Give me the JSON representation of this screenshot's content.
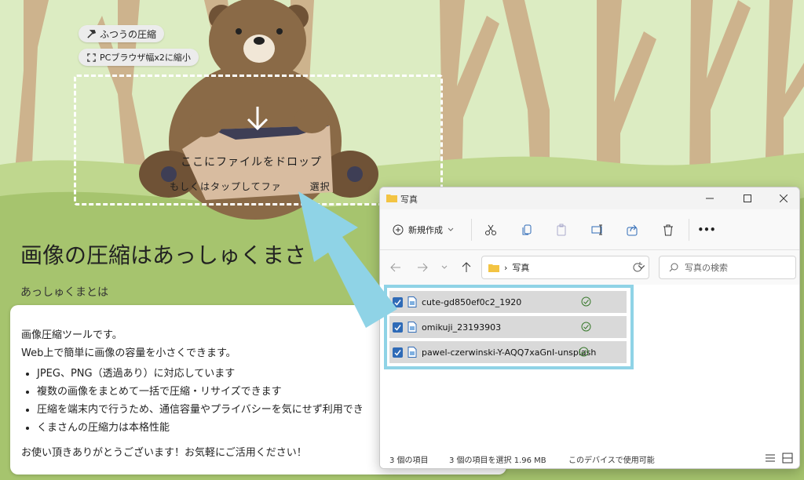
{
  "app": {
    "mode_chip": "ふつうの圧縮",
    "resize_chip": "PCブラウザ幅x2に縮小",
    "drop_title": "ここにファイルをドロップ",
    "drop_sub": "もしくはタップしてファ",
    "drop_sub_tail": "選択",
    "page_title": "画像の圧縮はあっしゅくまさ",
    "section_sub": "あっしゅくまとは",
    "card": {
      "intro1": "画像圧縮ツールです。",
      "intro2": "Web上で簡単に画像の容量を小さくできます。",
      "features": [
        "JPEG、PNG（透過あり）に対応しています",
        "複数の画像をまとめて一括で圧縮・リサイズできます",
        "圧縮を端末内で行うため、通信容量やプライバシーを気にせず利用でき",
        "くまさんの圧縮力は本格性能"
      ],
      "thanks": "お使い頂きありがとうございます！お気軽にご活用ください！"
    }
  },
  "explorer": {
    "title": "写真",
    "new_label": "新規作成",
    "address_folder": "写真",
    "address_sep": "›",
    "search_placeholder": "写真の検索",
    "files": [
      {
        "name": "cute-gd850ef0c2_1920",
        "checked": true
      },
      {
        "name": "omikuji_23193903",
        "checked": true
      },
      {
        "name": "pawel-czerwinski-Y-AQQ7xaGnI-unsplash",
        "checked": true
      }
    ],
    "status": {
      "count": "3 個の項目",
      "selected": "3 個の項目を選択  1.96 MB",
      "availability": "このデバイスで使用可能"
    },
    "more_label": "•••"
  },
  "colors": {
    "sky": "#dcecc2",
    "ground": "#a6c46e",
    "tree": "#cdb38d",
    "bear": "#8a6a47",
    "highlight": "#8fd3e6",
    "checkbox": "#2f6bb7"
  }
}
